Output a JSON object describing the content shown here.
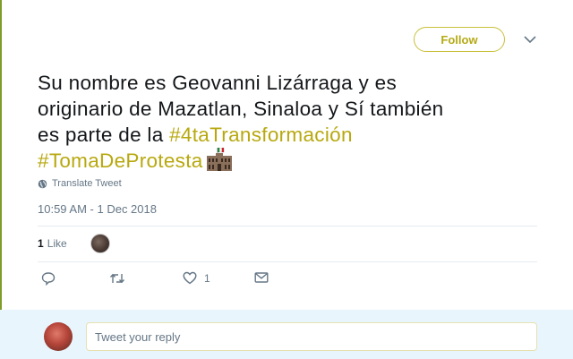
{
  "header": {
    "follow_label": "Follow",
    "menu_icon": "chevron-down-icon"
  },
  "tweet": {
    "text_line1": "Su nombre es Geovanni Lizárraga  y es",
    "text_line2": "originario  de  Mazatlan, Sinaloa  y Sí también",
    "text_line3_prefix": "es parte de la ",
    "hashtag1": "#4taTransformación",
    "hashtag2": "#TomaDeProtesta",
    "emoji": "mexican-palace-flag-emoji",
    "translate_label": "Translate Tweet",
    "timestamp": "10:59 AM - 1 Dec 2018"
  },
  "stats": {
    "likes_count": "1",
    "likes_label": "Like"
  },
  "actions": {
    "reply_icon": "reply-icon",
    "retweet_icon": "retweet-icon",
    "like_icon": "heart-icon",
    "like_count": "1",
    "dm_icon": "envelope-icon"
  },
  "reply": {
    "placeholder": "Tweet your reply"
  },
  "colors": {
    "accent": "#b8a80f",
    "follow_border": "#c9c03a",
    "muted": "#657786",
    "reply_bar_bg": "#e8f5fd"
  }
}
